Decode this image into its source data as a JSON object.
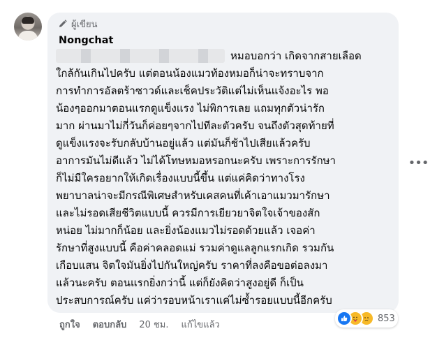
{
  "comment": {
    "badge_label": "ผู้เขียน",
    "author_name": "Nongchat",
    "lines": [
      "หมอบอกว่า เกิดจากสายเลือด",
      "ใกล้กันเกินไปครับ แต่ตอนน้องแมวท้องหมอก็น่าจะทราบจาก",
      "การทำการอัลตร้าซาวด์และเช็คประวัติแต่ไม่เห็นแจ้งอะไร พอ",
      "น้องๆออกมาตอนแรกดูแข็งแรง ไม่พิการเลย แถมทุกตัวน่ารัก",
      "มาก ผ่านมาไม่กี่วันก็ค่อยๆจากไปทีละตัวครับ จนถึงตัวสุดท้ายที่",
      "ดูแข็งแรงจะรับกลับบ้านอยู่แล้ว แต่มันก็ช้าไปเสียแล้วครับ",
      "อาการมันไม่ดีแล้ว ไม่ได้โทษหมอหรอกนะครับ เพราะการรักษา",
      "ก็ไม่มีใครอยากให้เกิดเรื่องแบบนี้ขึ้น แต่แค่คิดว่าทางโรง",
      "พยาบาลน่าจะมีกรณีพิเศษสำหรับเคสคนที่เค้าเอาแมวมารักษา",
      "และไม่รอดเสียชีวิตแบบนี้ ควรมีการเยียวยาจิตใจเจ้าของสัก",
      "หน่อย ไม่มากก็น้อย และยิ่งน้องแมวไม่รอดด้วยแล้ว เจอค่า",
      "รักษาที่สูงแบบนี้ คือค่าคลอดแม่ รวมค่าดูแลลูกแรกเกิด รวมกัน",
      "เกือบแสน จิตใจมันยิ่งไปกันใหญ่ครับ ราคาที่ลงคือขอต่อลงมา",
      "แล้วนะครับ ตอนแรกยิ่งกว่านี้ แต่ก็ยังคิดว่าสูงอยู่ดี ก็เป็น",
      "ประสบการณ์ครับ แค่ว่ารอบหน้าเราแค่ไม่ซ้ำรอยแบบนี้อีกครับ"
    ]
  },
  "actions": {
    "like_label": "ถูกใจ",
    "reply_label": "ตอบกลับ",
    "timestamp": "20 ชม.",
    "edited_label": "แก้ไขแล้ว"
  },
  "reactions": {
    "count": "853",
    "icons": [
      "like-icon",
      "care-icon",
      "sad-icon"
    ]
  },
  "colors": {
    "bubble": "#f0f2f5",
    "secondary_text": "#65676b",
    "like_blue": "#1877f2",
    "emoji_yellow": "#f7b928"
  }
}
